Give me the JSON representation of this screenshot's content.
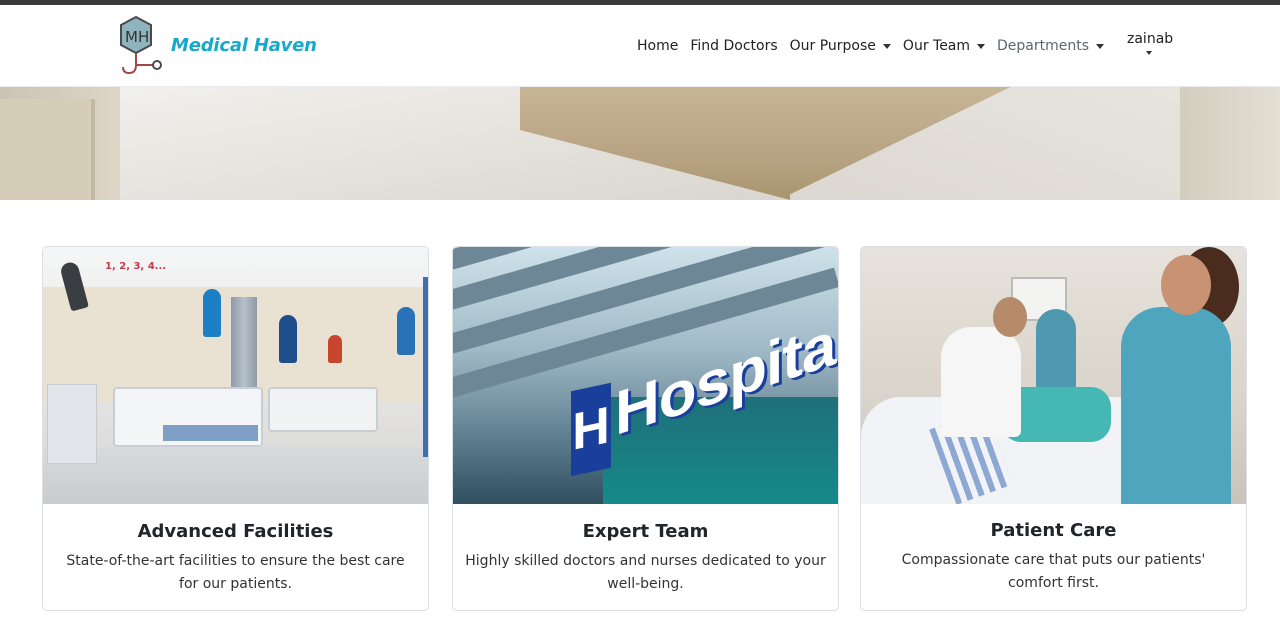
{
  "navbar": {
    "brand": "Medical Haven",
    "links": [
      {
        "label": "Home",
        "dropdown": false
      },
      {
        "label": "Find Doctors",
        "dropdown": false
      },
      {
        "label": "Our Purpose",
        "dropdown": true
      },
      {
        "label": "Our Team",
        "dropdown": true
      },
      {
        "label": "Departments",
        "dropdown": true
      }
    ],
    "user": "zainab"
  },
  "cards": [
    {
      "title": "Advanced Facilities",
      "text": "State-of-the-art facilities to ensure the best care for our patients."
    },
    {
      "title": "Expert Team",
      "text": "Highly skilled doctors and nurses dedicated to your well-being.",
      "sign_text": "Hospital",
      "sign_letter": "H"
    },
    {
      "title": "Patient Care",
      "text": "Compassionate care that puts our patients' comfort first."
    }
  ],
  "colors": {
    "brand": "#17a9c9",
    "topbar": "#3a3a3a",
    "card_border": "#dcdfe3"
  }
}
